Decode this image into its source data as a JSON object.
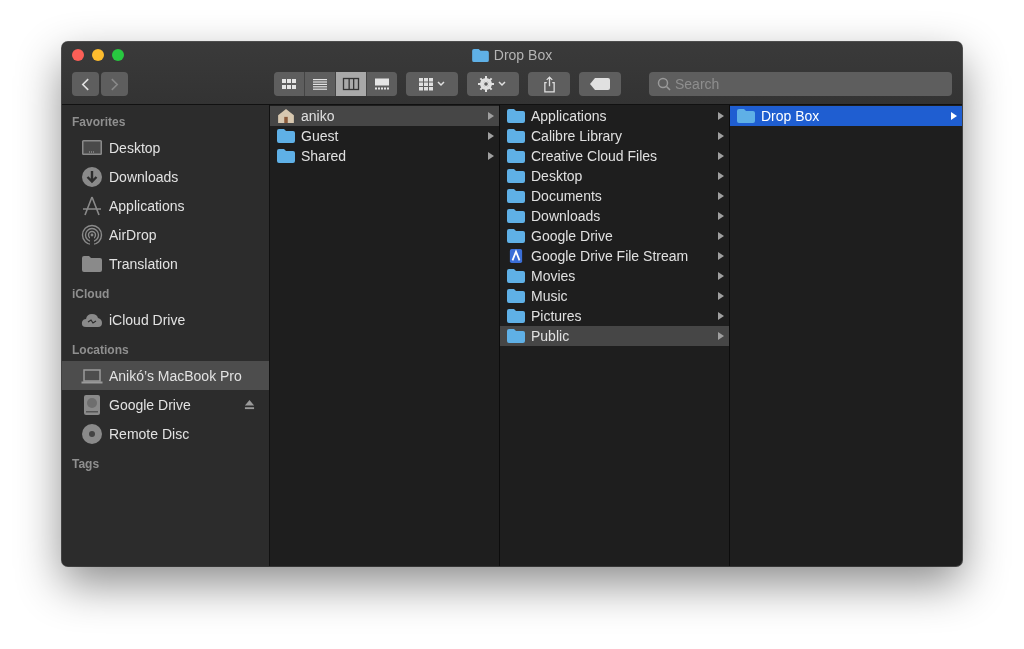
{
  "window": {
    "title": "Drop Box"
  },
  "toolbar": {
    "back": {
      "disabled": false
    },
    "forward": {
      "disabled": true
    },
    "view_modes": [
      {
        "kind": "icons",
        "selected": false
      },
      {
        "kind": "list",
        "selected": false
      },
      {
        "kind": "columns",
        "selected": true
      },
      {
        "kind": "gallery",
        "selected": false
      }
    ],
    "search": {
      "placeholder": "Search"
    }
  },
  "sidebar": {
    "sections": [
      {
        "title": "Favorites",
        "items": [
          {
            "label": "Desktop",
            "kind": "display",
            "selected": false,
            "ejectable": false
          },
          {
            "label": "Downloads",
            "kind": "download",
            "selected": false,
            "ejectable": false
          },
          {
            "label": "Applications",
            "kind": "apps",
            "selected": false,
            "ejectable": false
          },
          {
            "label": "AirDrop",
            "kind": "airdrop",
            "selected": false,
            "ejectable": false
          },
          {
            "label": "Translation",
            "kind": "folder",
            "selected": false,
            "ejectable": false
          }
        ]
      },
      {
        "title": "iCloud",
        "items": [
          {
            "label": "iCloud Drive",
            "kind": "cloud",
            "selected": false,
            "ejectable": false
          }
        ]
      },
      {
        "title": "Locations",
        "items": [
          {
            "label": "Anikó’s MacBook Pro",
            "kind": "laptop",
            "selected": true,
            "ejectable": false
          },
          {
            "label": "Google Drive",
            "kind": "disk",
            "selected": false,
            "ejectable": true
          },
          {
            "label": "Remote Disc",
            "kind": "disc",
            "selected": false,
            "ejectable": false
          }
        ]
      },
      {
        "title": "Tags"
      }
    ]
  },
  "columns": [
    {
      "active": false,
      "items": [
        {
          "label": "aniko",
          "kind": "home",
          "selected": true,
          "has_children": true
        },
        {
          "label": "Guest",
          "kind": "folder",
          "selected": false,
          "has_children": true
        },
        {
          "label": "Shared",
          "kind": "folder",
          "selected": false,
          "has_children": true
        }
      ]
    },
    {
      "active": false,
      "items": [
        {
          "label": "Applications",
          "kind": "folder",
          "selected": false,
          "has_children": true
        },
        {
          "label": "Calibre Library",
          "kind": "folder",
          "selected": false,
          "has_children": true
        },
        {
          "label": "Creative Cloud Files",
          "kind": "folder",
          "selected": false,
          "has_children": true
        },
        {
          "label": "Desktop",
          "kind": "folder",
          "selected": false,
          "has_children": true
        },
        {
          "label": "Documents",
          "kind": "folder",
          "selected": false,
          "has_children": true
        },
        {
          "label": "Downloads",
          "kind": "folder",
          "selected": false,
          "has_children": true
        },
        {
          "label": "Google Drive",
          "kind": "folder",
          "selected": false,
          "has_children": true
        },
        {
          "label": "Google Drive File Stream",
          "kind": "app",
          "selected": false,
          "has_children": true
        },
        {
          "label": "Movies",
          "kind": "folder",
          "selected": false,
          "has_children": true
        },
        {
          "label": "Music",
          "kind": "folder",
          "selected": false,
          "has_children": true
        },
        {
          "label": "Pictures",
          "kind": "folder",
          "selected": false,
          "has_children": true
        },
        {
          "label": "Public",
          "kind": "folder",
          "selected": true,
          "has_children": true
        }
      ]
    },
    {
      "active": true,
      "items": [
        {
          "label": "Drop Box",
          "kind": "folder",
          "selected": true,
          "has_children": true
        }
      ]
    }
  ]
}
